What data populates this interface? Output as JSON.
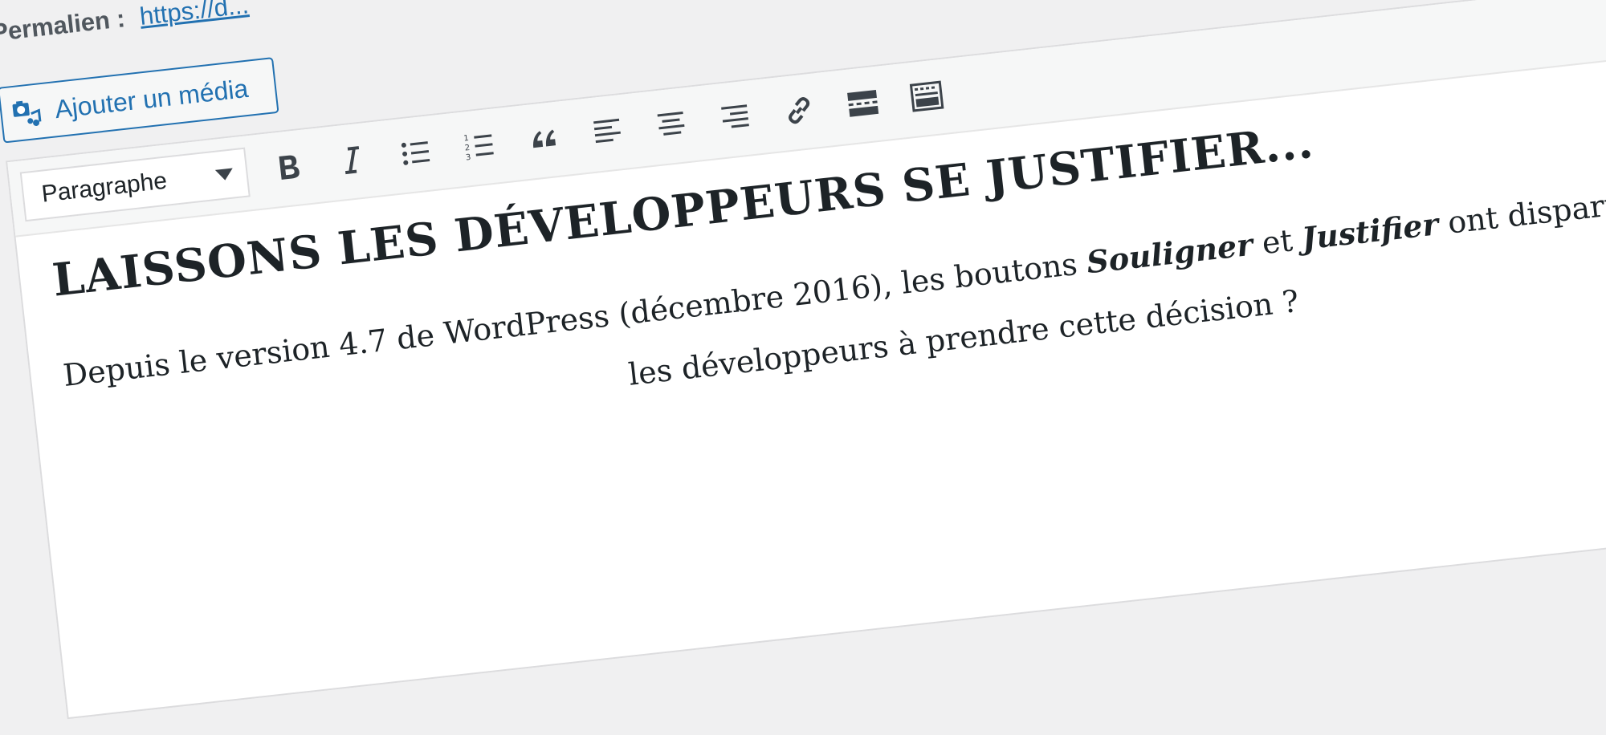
{
  "permalink": {
    "label": "Permalien :",
    "url_text": "https://d..."
  },
  "media_button": {
    "label": "Ajouter un média",
    "icon": "add-media-icon"
  },
  "toolbar": {
    "format_select": "Paragraphe",
    "buttons": [
      {
        "name": "bold",
        "icon": "bold-icon"
      },
      {
        "name": "italic",
        "icon": "italic-icon"
      },
      {
        "name": "bulleted-list",
        "icon": "unordered-list-icon"
      },
      {
        "name": "numbered-list",
        "icon": "ordered-list-icon"
      },
      {
        "name": "blockquote",
        "icon": "quote-icon"
      },
      {
        "name": "align-left",
        "icon": "align-left-icon"
      },
      {
        "name": "align-center",
        "icon": "align-center-icon"
      },
      {
        "name": "align-right",
        "icon": "align-right-icon"
      },
      {
        "name": "insert-link",
        "icon": "link-icon"
      },
      {
        "name": "insert-more",
        "icon": "read-more-icon"
      },
      {
        "name": "toolbar-toggle",
        "icon": "kitchen-sink-icon"
      }
    ]
  },
  "content": {
    "heading": "LAISSONS LES DÉVELOPPEURS SE JUSTIFIER...",
    "p1_before": "Depuis le version 4.7 de WordPress (décembre 2016), les boutons ",
    "p1_bold1": "Souligner",
    "p1_mid": " et ",
    "p1_bold2": "Justifier",
    "p1_after": " ont disparus de l’é",
    "p2_visible": "les développeurs à prendre cette décision ?"
  },
  "colors": {
    "accent": "#2271b1",
    "text": "#1d2327",
    "icon": "#3c434a",
    "background": "#f0f0f1"
  }
}
